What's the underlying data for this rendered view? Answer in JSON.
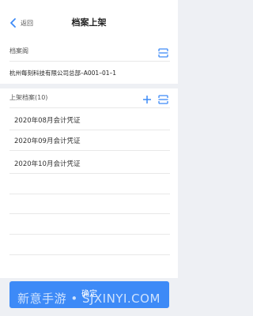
{
  "header": {
    "back_label": "返回",
    "title": "档案上架"
  },
  "archive_section": {
    "label": "档案阁",
    "icon": "scan-icon",
    "location": "杭州每刻科技有限公司总部–A001–01–1"
  },
  "shelf_section": {
    "label": "上架档案(10)",
    "icons": [
      "plus-icon",
      "scan-icon"
    ],
    "items": [
      "2020年08月会计凭证",
      "2020年09月会计凭证",
      "2020年10月会计凭证"
    ]
  },
  "footer": {
    "confirm_label": "确定"
  },
  "watermark": "新意手游 • SJXINYI.COM",
  "colors": {
    "accent": "#3d8af7",
    "background": "#eef0f4"
  }
}
